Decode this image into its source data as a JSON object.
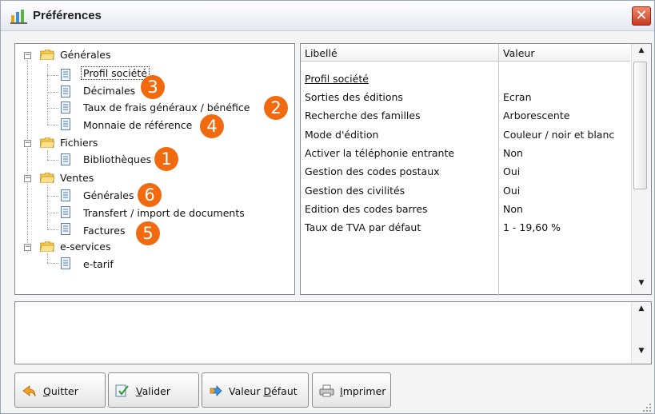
{
  "window": {
    "title": "Préférences",
    "close_glyph": "✕"
  },
  "tree": {
    "groups": [
      {
        "label": "Générales",
        "items": [
          "Profil société",
          "Décimales",
          "Taux de frais généraux / bénéfice",
          "Monnaie de référence"
        ]
      },
      {
        "label": "Fichiers",
        "items": [
          "Bibliothèques"
        ]
      },
      {
        "label": "Ventes",
        "items": [
          "Générales",
          "Transfert / import de documents",
          "Factures"
        ]
      },
      {
        "label": "e-services",
        "items": [
          "e-tarif"
        ]
      }
    ],
    "selected": "Profil société"
  },
  "badges": [
    "1",
    "2",
    "3",
    "4",
    "5",
    "6"
  ],
  "grid": {
    "headers": {
      "label": "Libellé",
      "value": "Valeur"
    },
    "rows": [
      {
        "label": "Profil société",
        "value": ""
      },
      {
        "label": "Sorties des éditions",
        "value": "Ecran"
      },
      {
        "label": "Recherche des familles",
        "value": "Arborescente"
      },
      {
        "label": "Mode d'édition",
        "value": "Couleur / noir et blanc"
      },
      {
        "label": "Activer la téléphonie entrante",
        "value": "Non"
      },
      {
        "label": "Gestion des codes postaux",
        "value": "Oui"
      },
      {
        "label": "Gestion des civilités",
        "value": "Oui"
      },
      {
        "label": "Edition des codes barres",
        "value": "Non"
      },
      {
        "label": "Taux de TVA par défaut",
        "value": "1 - 19,60 %"
      }
    ]
  },
  "buttons": {
    "quit": {
      "mnemonic": "Q",
      "rest": "uitter"
    },
    "validate": {
      "mnemonic": "V",
      "rest": "alider"
    },
    "default": {
      "before": "Valeur ",
      "mnemonic": "D",
      "rest": "éfaut"
    },
    "print": {
      "mnemonic": "I",
      "rest": "mprimer"
    }
  },
  "colors": {
    "badge": "#f26a0f",
    "close": "#d9482b"
  },
  "icons": [
    "app-icon",
    "close-icon",
    "folder-icon",
    "document-icon",
    "quit-icon",
    "validate-icon",
    "default-value-icon",
    "print-icon",
    "resize-grip-icon"
  ]
}
